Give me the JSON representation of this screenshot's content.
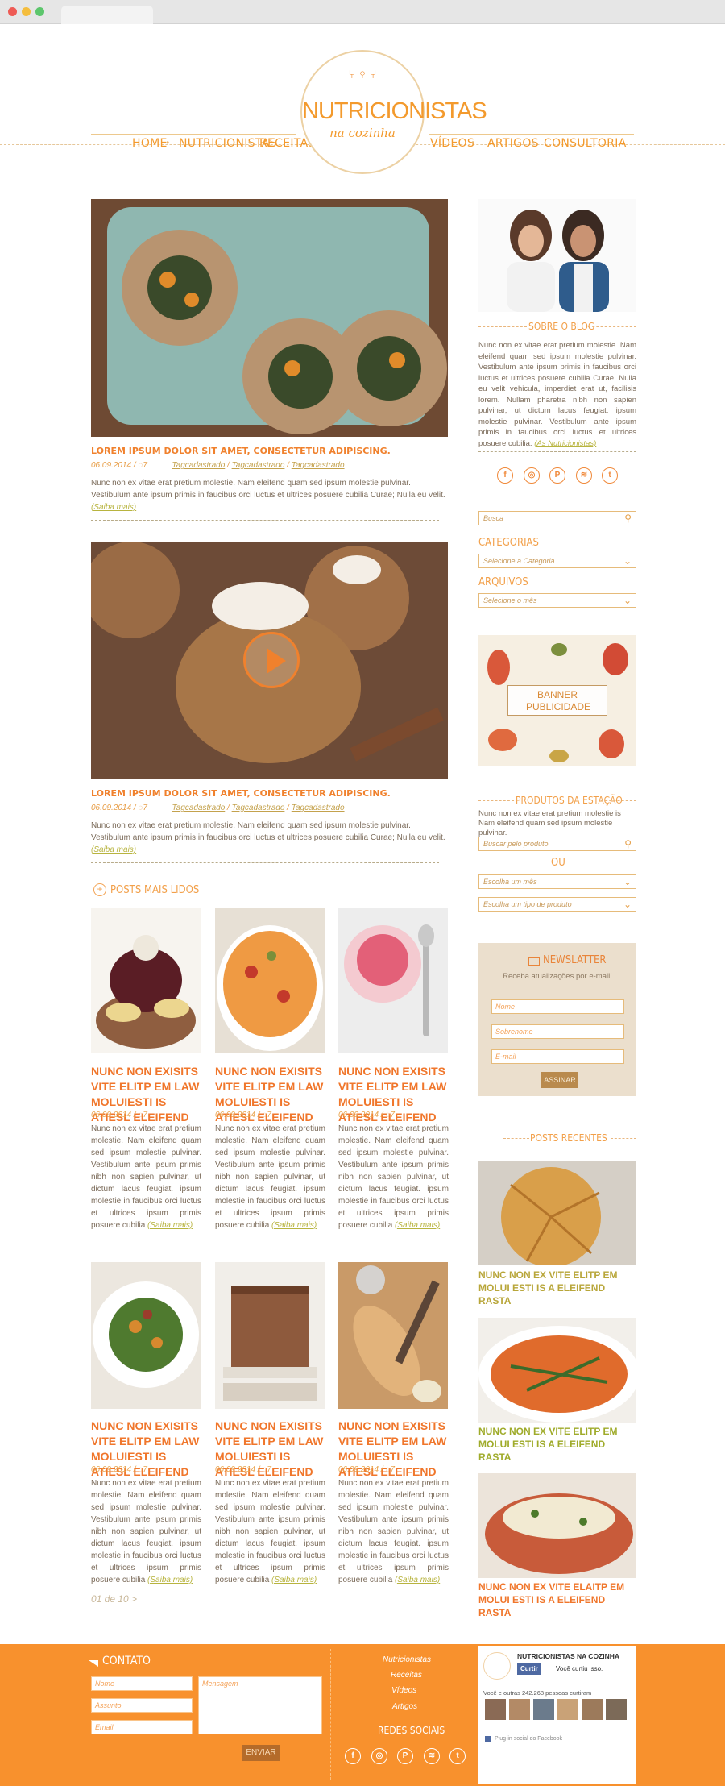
{
  "brand": {
    "title": "NUTRICIONISTAS",
    "subtitle": "na cozinha",
    "icon": "utensils-icon"
  },
  "nav": {
    "items": [
      "HOME",
      "NUTRICIONISTAS",
      "RECEITAS",
      "VÍDEOS",
      "ARTIGOS",
      "CONSULTORIA"
    ]
  },
  "posts": [
    {
      "title": "LOREM IPSUM DOLOR SIT AMET, CONSECTETUR ADIPISCING.",
      "date": "06.09.2014 /",
      "comments": "7",
      "tags": [
        "Tagcadastrado",
        "Tagcadastrado",
        "Tagcadastrado"
      ],
      "excerpt": "Nunc non ex vitae erat pretium molestie. Nam eleifend quam sed ipsum molestie pulvinar. Vestibulum ante ipsum primis in faucibus orci luctus et ultrices posuere cubilia Curae; Nulla eu velit.",
      "more": "(Saiba mais)"
    },
    {
      "title": "LOREM IPSUM DOLOR SIT AMET, CONSECTETUR ADIPISCING.",
      "date": "06.09.2014 /",
      "comments": "7",
      "tags": [
        "Tagcadastrado",
        "Tagcadastrado",
        "Tagcadastrado"
      ],
      "excerpt": "Nunc non ex vitae erat pretium molestie. Nam eleifend quam sed ipsum molestie pulvinar. Vestibulum ante ipsum primis in faucibus orci luctus et ultrices posuere cubilia Curae; Nulla eu velit.",
      "more": "(Saiba mais)"
    }
  ],
  "popular": {
    "heading": "POSTS MAIS LIDOS",
    "card": {
      "title": "NUNC NON EXISITS VITE ELITP EM LAW MOLUIESTI IS ATIESL ELEIFEND",
      "date": "06.09.2014 /",
      "comments": "7",
      "excerpt": "Nunc non ex vitae erat pretium molestie. Nam eleifend quam sed ipsum molestie pulvinar. Vestibulum ante ipsum primis nibh non sapien pulvinar, ut dictum lacus feugiat. ipsum molestie in faucibus orci luctus et ultrices ipsum primis posuere cubilia",
      "more": "(Saiba mais)"
    },
    "pagination": "01 de 10  >"
  },
  "sidebar": {
    "about": {
      "heading": "SOBRE O BLOG",
      "text": "Nunc non ex vitae erat pretium molestie. Nam eleifend quam sed ipsum molestie pulvinar. Vestibulum ante ipsum primis in faucibus orci luctus et ultrices posuere cubilia Curae; Nulla eu velit vehicula, imperdiet erat ut, facilisis lorem. Nullam pharetra nibh non sapien pulvinar, ut dictum lacus feugiat. ipsum molestie pulvinar. Vestibulum ante ipsum primis in faucibus orci luctus et ultrices posuere cubilia.",
      "more": "(As Nutricionistas)"
    },
    "social_icons": [
      "f",
      "◎",
      "P",
      "≋",
      "t"
    ],
    "search_placeholder": "Busca",
    "categories_label": "CATEGORIAS",
    "categories_select": "Selecione a Categoria",
    "archives_label": "ARQUIVOS",
    "archives_select": "Selecione o mês",
    "banner": "BANNER PUBLICIDADE",
    "produtos": {
      "heading": "PRODUTOS DA ESTAÇÃO",
      "text": "Nunc non ex vitae erat pretium molestie is Nam eleifend quam sed ipsum molestie pulvinar.",
      "search": "Buscar pelo produto",
      "or": "OU",
      "month": "Escolha um mês",
      "type": "Escolha um tipo de produto"
    },
    "newsletter": {
      "heading": "NEWSLATTER",
      "text": "Receba atualizações por e-mail!",
      "name": "Nome",
      "surname": "Sobrenome",
      "email": "E-mail",
      "button": "ASSINAR"
    },
    "recent": {
      "heading": "POSTS RECENTES",
      "items": [
        {
          "title": "NUNC NON EX VITE ELITP EM MOLUI ESTI IS A ELEIFEND RASTA"
        },
        {
          "title": "NUNC NON EX VITE ELITP EM MOLUI ESTI IS A ELEIFEND RASTA"
        },
        {
          "title": "NUNC NON EX VITE ELAITP EM MOLUI ESTI IS A ELEIFEND RASTA"
        }
      ]
    }
  },
  "footer": {
    "contact": {
      "heading": "CONTATO",
      "name": "Nome",
      "subject": "Assunto",
      "email": "Email",
      "message": "Mensagem",
      "send": "ENVIAR"
    },
    "links": [
      "Nutricionistas",
      "Receitas",
      "Vídeos",
      "Artigos"
    ],
    "social_heading": "REDES SOCIAIS",
    "facebook": {
      "page": "NUTRICIONISTAS NA COZINHA",
      "like": "Curtir",
      "liked": "Você curtiu isso.",
      "count": "Você e outras 242.268 pessoas curtiram",
      "plugin": "Plug-in social do Facebook"
    }
  },
  "colors": {
    "accent": "#f39a2d",
    "footer": "#f8912d",
    "title": "#f0762b",
    "tag": "#c4a24d"
  }
}
